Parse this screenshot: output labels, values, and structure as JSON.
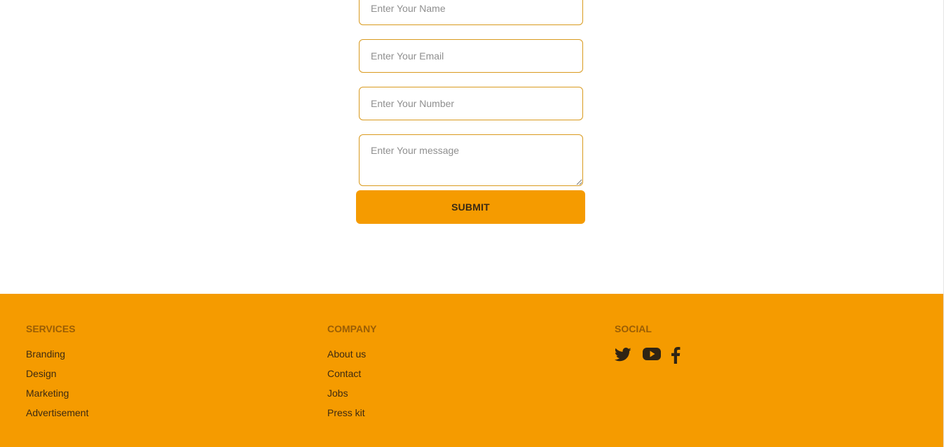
{
  "form": {
    "name_placeholder": "Enter Your Name",
    "email_placeholder": "Enter Your Email",
    "number_placeholder": "Enter Your Number",
    "message_placeholder": "Enter Your message",
    "submit_label": "SUBMIT"
  },
  "footer": {
    "services": {
      "title": "SERVICES",
      "links": [
        "Branding",
        "Design",
        "Marketing",
        "Advertisement"
      ]
    },
    "company": {
      "title": "COMPANY",
      "links": [
        "About us",
        "Contact",
        "Jobs",
        "Press kit"
      ]
    },
    "social": {
      "title": "SOCIAL",
      "icons": [
        "twitter-icon",
        "youtube-icon",
        "facebook-icon"
      ]
    }
  },
  "colors": {
    "accent": "#f59b00",
    "field_border": "#d99a1e",
    "footer_heading": "#9a5e05",
    "footer_text": "#3d2a12"
  }
}
